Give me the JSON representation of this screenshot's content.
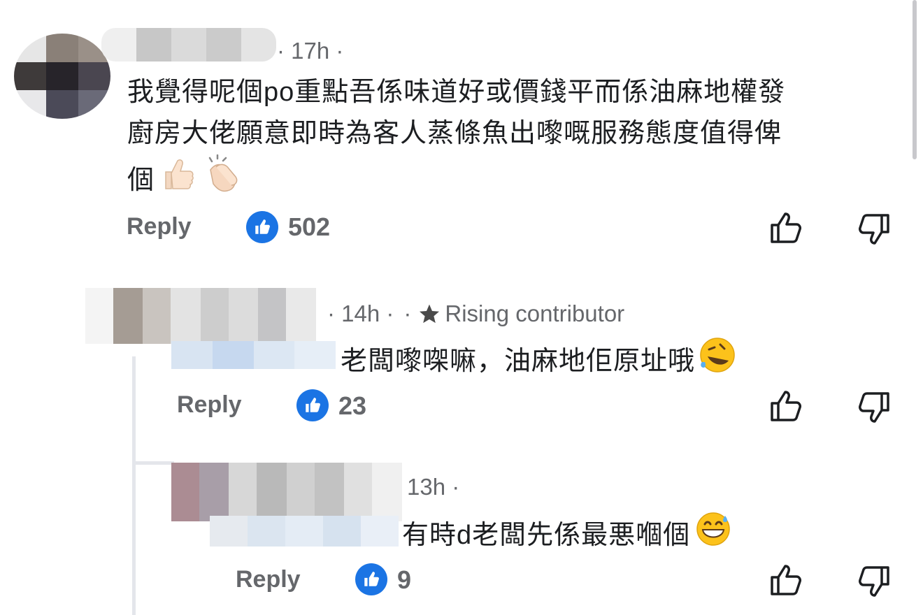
{
  "comments": [
    {
      "time": "· 17h ·",
      "text_line1": "我覺得呢個po重點吾係味道好或價錢平而係油麻地權發",
      "text_line2": "廚房大佬願意即時為客人蒸條魚出嚟嘅服務態度值得俾",
      "text_line3": "個",
      "emoji": [
        "thumbs-up",
        "clapping-hands"
      ],
      "reply_label": "Reply",
      "like_count": "502"
    },
    {
      "time": "· 14h ·",
      "dot": "·",
      "badge": "Rising contributor",
      "text": "老闆嚟㗎嘛，油麻地佢原址哦",
      "emoji": [
        "rolling-laughing"
      ],
      "reply_label": "Reply",
      "like_count": "23"
    },
    {
      "time": "13h ·",
      "text": "有時d老闆先係最悪嗰個",
      "emoji": [
        "grinning-sweat"
      ],
      "reply_label": "Reply",
      "like_count": "9"
    }
  ],
  "colors": {
    "like_blue": "#1b74e4",
    "meta_gray": "#65676b",
    "text": "#1c1e21"
  },
  "icons": [
    "thumbs-up-icon",
    "thumbs-down-icon",
    "star-icon",
    "like-badge-icon"
  ]
}
